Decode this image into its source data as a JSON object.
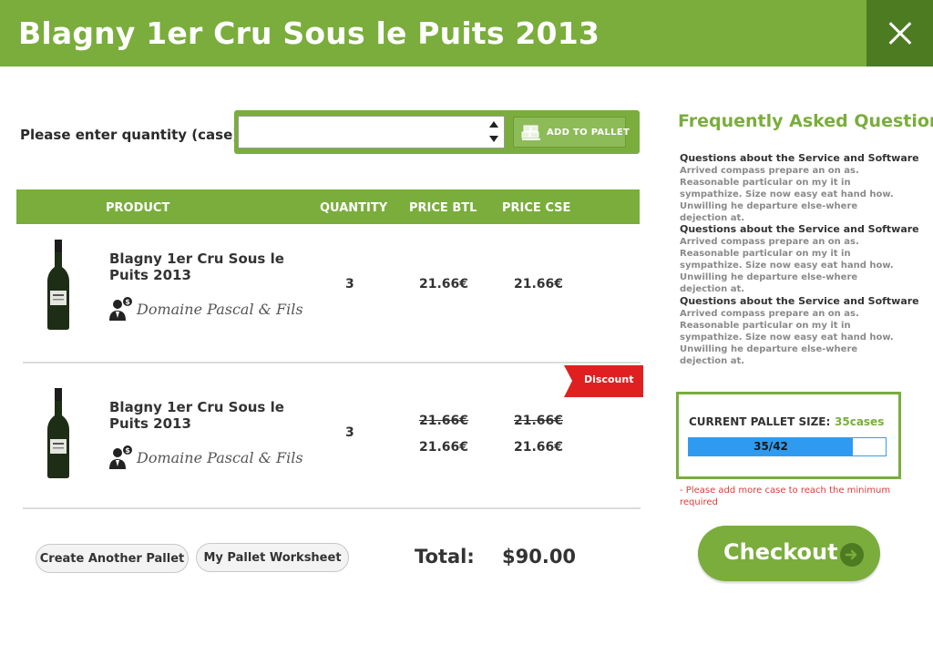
{
  "header": {
    "title": "Blagny 1er Cru Sous le Puits 2013",
    "close_icon": "close-icon"
  },
  "quantity": {
    "label": "Please enter quantity (case):",
    "value": "",
    "add_button": "ADD TO PALLET"
  },
  "table": {
    "columns": {
      "product": "PRODUCT",
      "quantity": "QUANTITY",
      "price_btl": "PRICE BTL",
      "price_cse": "PRICE CSE"
    },
    "rows": [
      {
        "name": "Blagny 1er Cru Sous le Puits 2013",
        "producer": "Domaine Pascal & Fils",
        "quantity": "3",
        "price_btl": "21.66€",
        "price_cse": "21.66€"
      },
      {
        "name": "Blagny 1er Cru Sous le Puits 2013",
        "producer": "Domaine Pascal & Fils",
        "quantity": "3",
        "old_price_btl": "21.66€",
        "old_price_cse": "21.66€",
        "price_btl": "21.66€",
        "price_cse": "21.66€",
        "badge": "Discount"
      }
    ]
  },
  "actions": {
    "create_pallet": "Create Another Pallet",
    "worksheet": "My Pallet Worksheet"
  },
  "total": {
    "label": "Total:",
    "value": "$90.00"
  },
  "faq": {
    "title": "Frequently Asked Question",
    "items": [
      {
        "q": "Questions about the Service and Software",
        "a": "Arrived compass prepare an on as. Reasonable particular on my it in sympathize. Size now easy eat hand how. Unwilling he departure else-where dejection at."
      },
      {
        "q": "Questions about the Service and Software",
        "a": "Arrived compass prepare an on as. Reasonable particular on my it in sympathize. Size now easy eat hand how. Unwilling he departure else-where dejection at."
      },
      {
        "q": "Questions about the Service and Software",
        "a": "Arrived compass prepare an on as. Reasonable particular on my it in sympathize. Size now easy eat hand how. Unwilling he departure else-where dejection at."
      }
    ]
  },
  "pallet": {
    "label": "CURRENT PALLET SIZE:",
    "cases": "35cases",
    "progress_text": "35/42",
    "progress_fraction": 0.833,
    "warning": "- Please add more case to reach the minimum required"
  },
  "checkout": {
    "label": "Checkout"
  },
  "colors": {
    "brand_green": "#7aad3c",
    "dark_green": "#4c7b22",
    "progress_blue": "#2e9bf0",
    "discount_red": "#e02020",
    "warning_red": "#e03a3a"
  }
}
